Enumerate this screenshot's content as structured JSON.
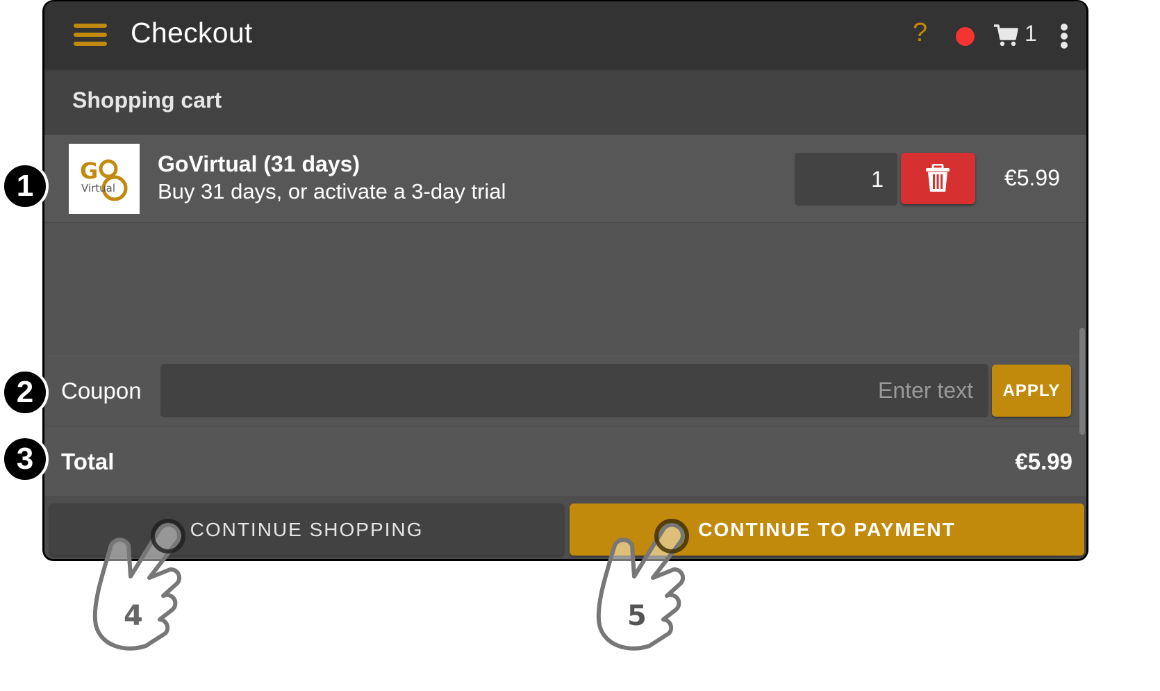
{
  "appbar": {
    "title": "Checkout",
    "cart_count": "1",
    "icons": [
      "menu-icon",
      "help-icon",
      "record-status-icon",
      "cart-icon",
      "more-options-icon"
    ],
    "help_glyph": "?",
    "record_color": "#f53333",
    "accent_color": "#c28a0c"
  },
  "cart": {
    "section_title": "Shopping cart",
    "items": [
      {
        "thumb_text_top": "Go",
        "thumb_text_bottom": "Virtual",
        "name": "GoVirtual (31 days)",
        "description": "Buy 31 days, or activate a 3-day trial",
        "quantity": "1",
        "price": "€5.99"
      }
    ]
  },
  "coupon": {
    "label": "Coupon",
    "value": "",
    "placeholder": "Enter text",
    "apply_label": "APPLY"
  },
  "total": {
    "label": "Total",
    "value": "€5.99"
  },
  "footer": {
    "continue_shopping_label": "CONTINUE SHOPPING",
    "continue_payment_label": "CONTINUE TO PAYMENT"
  },
  "callouts": [
    "1",
    "2",
    "3",
    "4",
    "5"
  ],
  "colors": {
    "delete": "#d73030",
    "primary": "#c28a0c"
  }
}
